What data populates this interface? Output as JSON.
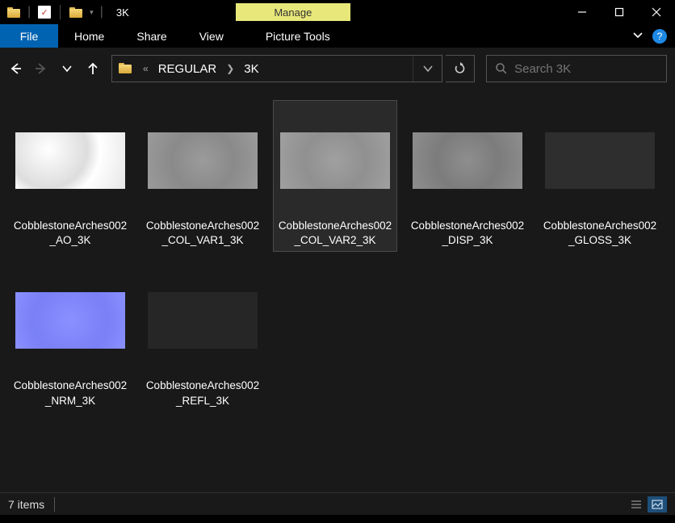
{
  "window": {
    "title": "3K",
    "manage_label": "Manage"
  },
  "ribbon": {
    "file": "File",
    "tabs": [
      "Home",
      "Share",
      "View"
    ],
    "context_tab": "Picture Tools"
  },
  "address": {
    "crumbs": [
      "REGULAR",
      "3K"
    ]
  },
  "search": {
    "placeholder": "Search 3K"
  },
  "items": [
    {
      "name": "CobblestoneArches002_AO_3K",
      "thumb_class": "tx-ao",
      "selected": false
    },
    {
      "name": "CobblestoneArches002_COL_VAR1_3K",
      "thumb_class": "tx-col1",
      "selected": false
    },
    {
      "name": "CobblestoneArches002_COL_VAR2_3K",
      "thumb_class": "tx-col2",
      "selected": true
    },
    {
      "name": "CobblestoneArches002_DISP_3K",
      "thumb_class": "tx-disp",
      "selected": false
    },
    {
      "name": "CobblestoneArches002_GLOSS_3K",
      "thumb_class": "tx-gloss",
      "selected": false
    },
    {
      "name": "CobblestoneArches002_NRM_3K",
      "thumb_class": "tx-nrm",
      "selected": false
    },
    {
      "name": "CobblestoneArches002_REFL_3K",
      "thumb_class": "tx-refl",
      "selected": false
    }
  ],
  "status": {
    "count_label": "7 items"
  }
}
